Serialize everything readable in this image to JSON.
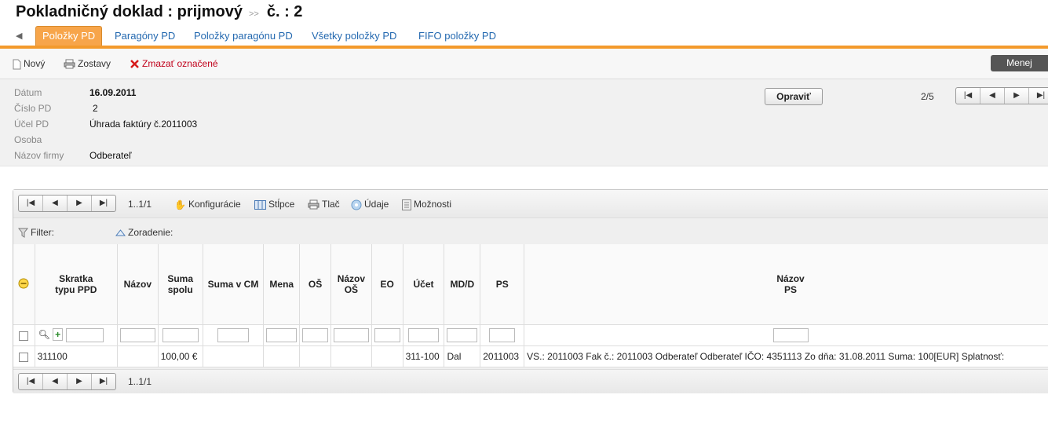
{
  "header": {
    "title_left": "Pokladničný doklad : prijmový",
    "separator": ">>",
    "title_right": "č. : 2"
  },
  "tabs": [
    "Položky PD",
    "Paragóny PD",
    "Položky paragónu PD",
    "Všetky položky PD",
    "FIFO položky PD"
  ],
  "toolbar": {
    "new": "Nový",
    "reports": "Zostavy",
    "delete": "Zmazať označené",
    "less": "Menej"
  },
  "form": {
    "labels": [
      "Dátum",
      "Číslo PD",
      "Účel PD",
      "Osoba",
      "Názov firmy"
    ],
    "values": [
      "16.09.2011",
      "2",
      "Úhrada faktúry č.2011003",
      "",
      "Odberateľ"
    ],
    "edit_button": "Opraviť",
    "position": "2/5"
  },
  "grid": {
    "page_info": "1..1/1",
    "toolbar": {
      "config": "Konfigurácie",
      "columns": "Stĺpce",
      "print": "Tlač",
      "data": "Údaje",
      "options": "Možnosti"
    },
    "filter_label": "Filter:",
    "sort_label": "Zoradenie:",
    "columns": [
      "Skratka typu PPD",
      "Názov",
      "Suma spolu",
      "Suma v CM",
      "Mena",
      "OŠ",
      "Názov OŠ",
      "EO",
      "Účet",
      "MD/D",
      "PS",
      "Názov PS"
    ],
    "rows": [
      {
        "skratka": "311100",
        "nazov": "",
        "suma": "100,00 €",
        "suma_cm": "",
        "mena": "",
        "os": "",
        "nazov_os": "",
        "eo": "",
        "ucet": "311-100",
        "mdd": "Dal",
        "ps": "2011003",
        "nazov_ps": "VS.: 2011003 Fak č.: 2011003 Odberateľ Odberateľ IČO: 4351113 Zo dňa: 31.08.2011 Suma: 100[EUR] Splatnosť:"
      }
    ]
  },
  "colors": {
    "accent": "#f39a2c",
    "tab_text": "#2469b0",
    "delete_text": "#c0001a"
  }
}
